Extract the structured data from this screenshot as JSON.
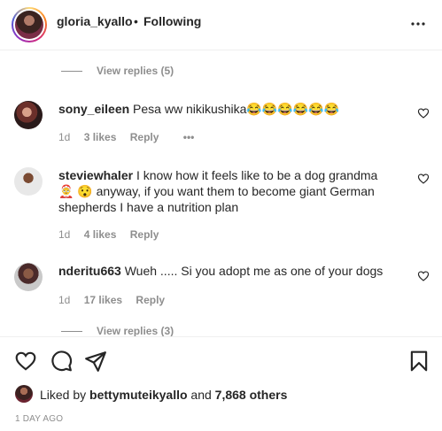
{
  "header": {
    "username": "gloria_kyallo",
    "separator": "•",
    "follow_status": "Following",
    "more_icon": "more-horizontal-icon"
  },
  "comments": {
    "view_replies_top": "View replies (5)",
    "view_replies_bottom": "View replies (3)",
    "items": [
      {
        "username": "sony_eileen",
        "text": "Pesa ww nikikushika😂😂😂😂😂😂",
        "age": "1d",
        "likes": "3 likes",
        "reply": "Reply",
        "options": "•••"
      },
      {
        "username": "steviewhaler",
        "text": "I know how it feels like to be a dog grandma 🤶 😯 anyway, if you want them to become giant German shepherds I have a nutrition plan",
        "age": "1d",
        "likes": "4 likes",
        "reply": "Reply"
      },
      {
        "username": "nderitu663",
        "text": "Wueh ..... Si you adopt me as one of your dogs",
        "age": "1d",
        "likes": "17 likes",
        "reply": "Reply"
      }
    ]
  },
  "actions": {
    "like_icon": "heart-icon",
    "comment_icon": "comment-icon",
    "share_icon": "share-icon",
    "save_icon": "bookmark-icon"
  },
  "likes_summary": {
    "prefix": "Liked by",
    "user": "bettymuteikyallo",
    "and": "and",
    "others": "7,868 others"
  },
  "timestamp": "1 DAY AGO"
}
